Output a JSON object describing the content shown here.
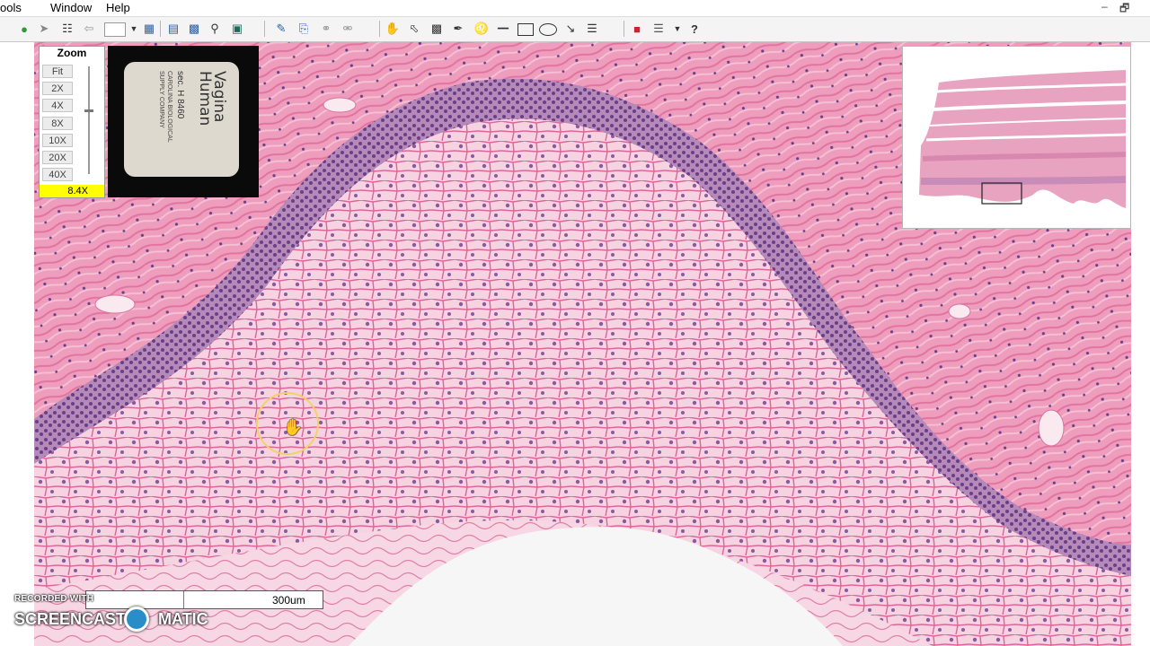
{
  "menubar": {
    "items": [
      "ools",
      "Window",
      "Help"
    ],
    "window_controls": [
      "–",
      "🗗"
    ]
  },
  "toolbar": {
    "icons": [
      "go-icon",
      "forward-icon",
      "tree-icon",
      "back-icon",
      "blank-icon",
      "dropdown-icon",
      "frame-icon",
      "layers-icon",
      "grid-icon",
      "magnify-icon",
      "screen-icon",
      "edit-icon",
      "annotation-icon",
      "link-icon",
      "unlink-icon",
      "hand-icon",
      "select-icon",
      "export-icon",
      "pen-icon",
      "measure-icon",
      "ruler-icon",
      "rectangle-icon",
      "ellipse-icon",
      "arrow-icon",
      "list-icon",
      "color-icon",
      "filter-icon",
      "dropdown2-icon",
      "help-icon"
    ]
  },
  "zoom": {
    "title": "Zoom",
    "options": [
      "Fit",
      "2X",
      "4X",
      "8X",
      "10X",
      "20X",
      "40X"
    ],
    "current": "8.4X"
  },
  "slide_label": {
    "line1": "Vagina",
    "line2": "Human",
    "line3": "sec.   H 8460",
    "line4": "CAROLINA BIOLOGICAL",
    "line5": "SUPPLY COMPANY"
  },
  "scalebar": {
    "text": "300um"
  },
  "watermark": {
    "line1": "RECORDED WITH",
    "line2": "SCREENCAST",
    "line3": "MATIC"
  },
  "colors": {
    "stroma": "#ee9dbd",
    "epithelium_pale": "#f6c9dc",
    "basal_layer": "#8a5aa0",
    "cell_border": "#d6689a",
    "zoom_highlight": "#ffff00",
    "cursor_ring": "#f0d266"
  }
}
